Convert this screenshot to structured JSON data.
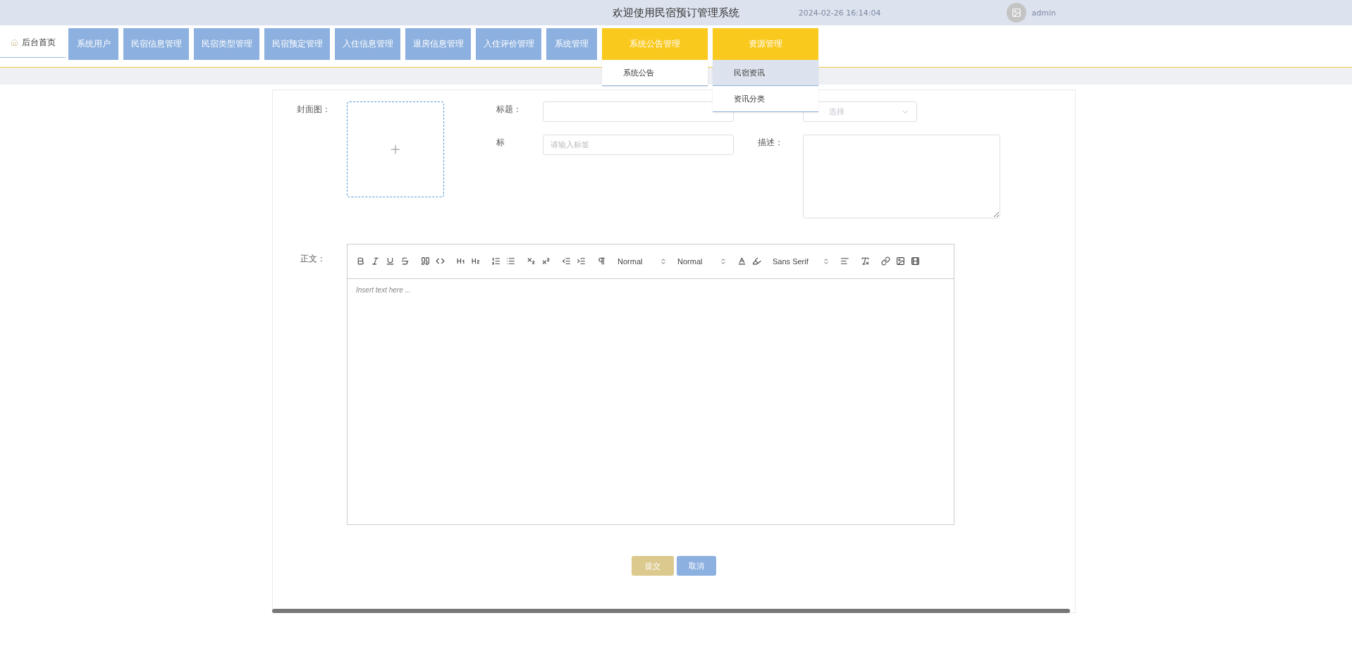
{
  "header": {
    "title": "欢迎使用民宿预订管理系统",
    "datetime": "2024-02-26 16:14:04",
    "user": "admin"
  },
  "nav": {
    "home": {
      "label": "后台首页",
      "selected": true
    },
    "items": [
      {
        "label": "系统用户",
        "expanded": false
      },
      {
        "label": "民宿信息管理",
        "expanded": false
      },
      {
        "label": "民宿类型管理",
        "expanded": false
      },
      {
        "label": "民宿预定管理",
        "expanded": false
      },
      {
        "label": "入住信息管理",
        "expanded": false
      },
      {
        "label": "退房信息管理",
        "expanded": false
      },
      {
        "label": "入住评价管理",
        "expanded": false
      },
      {
        "label": "系统管理",
        "expanded": false
      },
      {
        "label": "系统公告管理",
        "expanded": true,
        "children": [
          {
            "label": "系统公告",
            "selected": false
          }
        ]
      },
      {
        "label": "资源管理",
        "expanded": true,
        "children": [
          {
            "label": "民宿资讯",
            "selected": true
          },
          {
            "label": "资讯分类",
            "selected": false
          }
        ]
      }
    ]
  },
  "form": {
    "cover_label": "封面图：",
    "title_label": "标题：",
    "category_placeholder": "选择",
    "tag_label": "标",
    "tag_placeholder": "请输入标签",
    "description_label": "描述：",
    "body_label": "正文：",
    "editor": {
      "toolbar": [
        [
          {
            "kind": "bold"
          },
          {
            "kind": "italic"
          },
          {
            "kind": "underline"
          },
          {
            "kind": "strike"
          }
        ],
        [
          {
            "kind": "quote"
          },
          {
            "kind": "code"
          }
        ],
        [
          {
            "kind": "h1"
          },
          {
            "kind": "h2"
          }
        ],
        [
          {
            "kind": "ordered"
          },
          {
            "kind": "bullet"
          }
        ],
        [
          {
            "kind": "subscript"
          },
          {
            "kind": "superscript"
          }
        ],
        [
          {
            "kind": "outdent"
          },
          {
            "kind": "indent"
          }
        ],
        [
          {
            "kind": "direction"
          }
        ],
        [
          {
            "kind": "picker",
            "label": "Normal"
          }
        ],
        [
          {
            "kind": "picker",
            "label": "Normal"
          }
        ],
        [
          {
            "kind": "color"
          },
          {
            "kind": "background"
          }
        ],
        [
          {
            "kind": "picker",
            "label": "Sans Serif"
          }
        ],
        [
          {
            "kind": "align"
          }
        ],
        [
          {
            "kind": "clean"
          }
        ],
        [
          {
            "kind": "link"
          },
          {
            "kind": "image"
          },
          {
            "kind": "video"
          }
        ]
      ],
      "placeholder": "Insert text here ..."
    },
    "buttons": [
      {
        "label": "提交",
        "kind": "submit"
      },
      {
        "label": "取消",
        "kind": "cancel"
      }
    ]
  }
}
